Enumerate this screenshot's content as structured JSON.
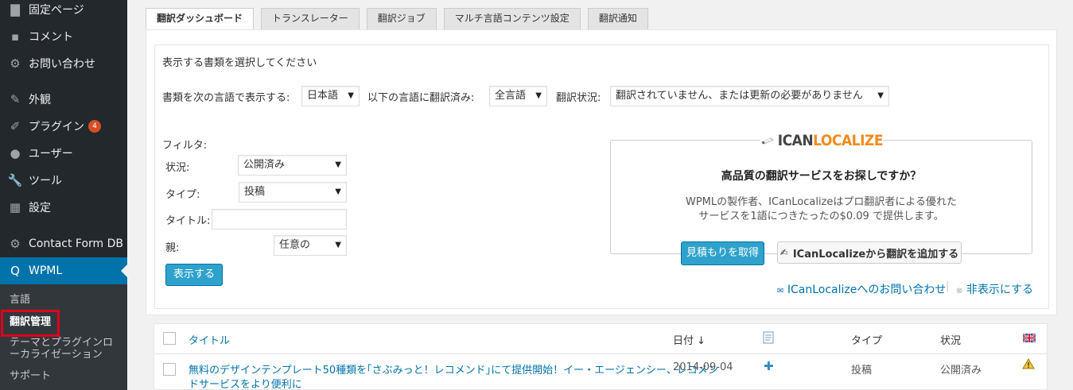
{
  "sidebar": {
    "items": [
      {
        "label": "固定ページ",
        "icon": "page-icon"
      },
      {
        "label": "コメント",
        "icon": "comment-icon"
      },
      {
        "label": "お問い合わせ",
        "icon": "gear-icon"
      },
      {
        "label": "外観",
        "icon": "brush-icon"
      },
      {
        "label": "プラグイン",
        "icon": "plugin-icon",
        "badge": "4"
      },
      {
        "label": "ユーザー",
        "icon": "user-icon"
      },
      {
        "label": "ツール",
        "icon": "wrench-icon"
      },
      {
        "label": "設定",
        "icon": "settings-icon"
      },
      {
        "label": "Contact Form DB",
        "icon": "gear-icon"
      },
      {
        "label": "WPML",
        "icon": "wpml-icon"
      }
    ],
    "submenu": [
      "言語",
      "翻訳管理",
      "テーマとプラグインローカライゼーション",
      "サポート"
    ]
  },
  "tabs": [
    "翻訳ダッシュボード",
    "トランスレーター",
    "翻訳ジョブ",
    "マルチ言語コンテンツ設定",
    "翻訳通知"
  ],
  "panel": {
    "heading": "表示する書類を選択してください",
    "lang_label": "書類を次の言語で表示する:",
    "lang_value": "日本語",
    "translated_label": "以下の言語に翻訳済み:",
    "translated_value": "全言語",
    "status_label": "翻訳状況:",
    "status_value": "翻訳されていません、または更新の必要がありません",
    "filter_label": "フィルタ:",
    "state_label": "状況:",
    "state_value": "公開済み",
    "type_label": "タイプ:",
    "type_value": "投稿",
    "title_label": "タイトル:",
    "title_value": "",
    "parent_label": "親:",
    "parent_value": "任意の",
    "show_button": "表示する"
  },
  "promo": {
    "logo_prefix": "ICAN",
    "logo_suffix": "LOCALIZE",
    "headline": "高品質の翻訳サービスをお探しですか？",
    "line1": "WPMLの製作者、ICanLocalizeはプロ翻訳者による優れた",
    "line2": "サービスを1語につきたったの$0.09 で提供します。",
    "quote_button": "見積もりを取得",
    "add_button": "ICanLocalizeから翻訳を追加する",
    "contact_link": "ICanLocalizeへのお問い合わせ",
    "hide_link": "非表示にする"
  },
  "table": {
    "headers": {
      "title": "タイトル",
      "date": "日付",
      "sort": "↓",
      "type": "タイプ",
      "status": "状況"
    },
    "rows": [
      {
        "title_line1": "無料のデザインテンプレート50種類を｢さぶみっと！レコメンド｣にて提供開始！イー・エージェンシー、レコメン",
        "title_line2": "ドサービスをより便利に",
        "date": "2014-09-04",
        "action": "✚",
        "type": "投稿",
        "status": "公開済み"
      }
    ]
  },
  "colors": {
    "sidebar_bg": "#23282d",
    "accent": "#0073aa",
    "highlight": "#e0001b"
  }
}
